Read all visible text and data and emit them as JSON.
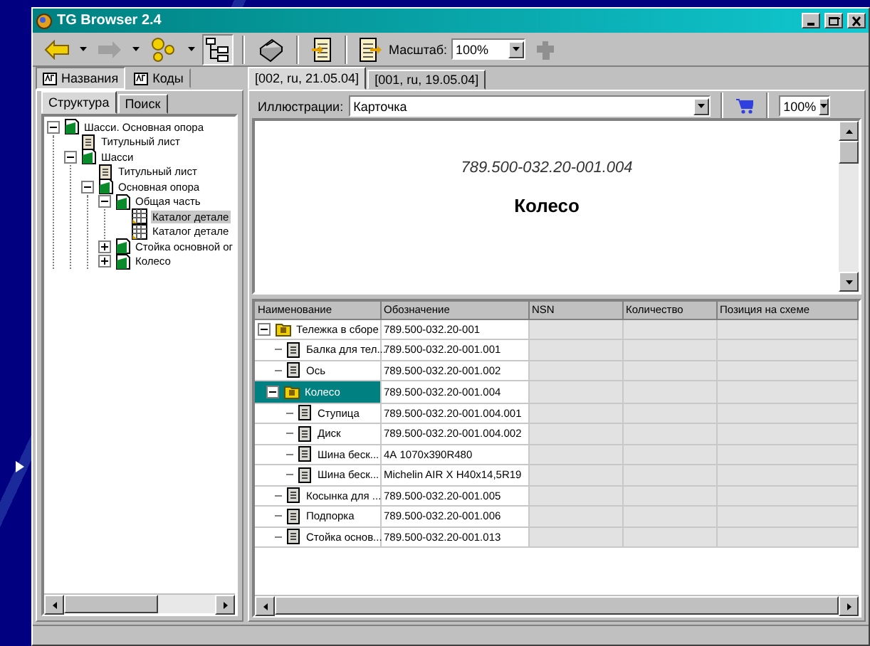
{
  "window": {
    "title": "TG Browser 2.4"
  },
  "toolbar": {
    "scale_label": "Масштаб:",
    "scale_value": "100%"
  },
  "view_tabs": [
    {
      "label": "Названия",
      "selected": true
    },
    {
      "label": "Коды",
      "selected": false
    }
  ],
  "doc_tabs": [
    {
      "label": "[002, ru, 21.05.04]",
      "selected": true
    },
    {
      "label": "[001, ru, 19.05.04]",
      "selected": false
    }
  ],
  "panel_tabs": [
    {
      "label": "Структура",
      "selected": true
    },
    {
      "label": "Поиск",
      "selected": false
    }
  ],
  "tree": [
    {
      "label": "Шасси. Основная опора",
      "kind": "assembly",
      "expanded": true,
      "selected": false,
      "children": [
        {
          "label": "Титульный лист",
          "kind": "document",
          "selected": false
        },
        {
          "label": "Шасси",
          "kind": "assembly",
          "expanded": true,
          "selected": false,
          "children": [
            {
              "label": "Титульный лист",
              "kind": "document",
              "selected": false
            },
            {
              "label": "Основная опора",
              "kind": "assembly",
              "expanded": true,
              "selected": false,
              "children": [
                {
                  "label": "Общая часть",
                  "kind": "assembly",
                  "expanded": true,
                  "selected": false,
                  "children": [
                    {
                      "label": "Каталог детале",
                      "kind": "catalog",
                      "selected": true
                    },
                    {
                      "label": "Каталог детале",
                      "kind": "catalog",
                      "selected": false
                    }
                  ]
                },
                {
                  "label": "Стойка основной ог",
                  "kind": "assembly",
                  "expanded": false,
                  "selected": false
                },
                {
                  "label": "Колесо",
                  "kind": "assembly",
                  "expanded": false,
                  "selected": false
                }
              ]
            }
          ]
        }
      ]
    }
  ],
  "illustrations": {
    "label": "Иллюстрации:",
    "value": "Карточка",
    "zoom": "100%"
  },
  "preview": {
    "code": "789.500-032.20-001.004",
    "title": "Колесо"
  },
  "table": {
    "columns": [
      "Наименование",
      "Обозначение",
      "NSN",
      "Количество",
      "Позиция на схеме"
    ],
    "rows": [
      {
        "name": "Тележка в сборе",
        "designation": "789.500-032.20-001",
        "kind": "assembly",
        "expanded": true,
        "selected": false,
        "children": [
          {
            "name": "Балка для тел...",
            "designation": "789.500-032.20-001.001",
            "kind": "part",
            "selected": false
          },
          {
            "name": "Ось",
            "designation": "789.500-032.20-001.002",
            "kind": "part",
            "selected": false
          },
          {
            "name": "Колесо",
            "designation": "789.500-032.20-001.004",
            "kind": "assembly",
            "expanded": true,
            "selected": true,
            "children": [
              {
                "name": "Ступица",
                "designation": "789.500-032.20-001.004.001",
                "kind": "part",
                "selected": false
              },
              {
                "name": "Диск",
                "designation": "789.500-032.20-001.004.002",
                "kind": "part",
                "selected": false
              },
              {
                "name": "Шина беск...",
                "designation": "4А 1070х390R480",
                "kind": "part",
                "selected": false
              },
              {
                "name": "Шина беск...",
                "designation": "Michelin AIR X H40x14,5R19",
                "kind": "part",
                "selected": false
              }
            ]
          },
          {
            "name": "Косынка для ...",
            "designation": "789.500-032.20-001.005",
            "kind": "part",
            "selected": false
          },
          {
            "name": "Подпорка",
            "designation": "789.500-032.20-001.006",
            "kind": "part",
            "selected": false
          },
          {
            "name": "Стойка основ...",
            "designation": "789.500-032.20-001.013",
            "kind": "part",
            "selected": false
          }
        ]
      }
    ]
  }
}
